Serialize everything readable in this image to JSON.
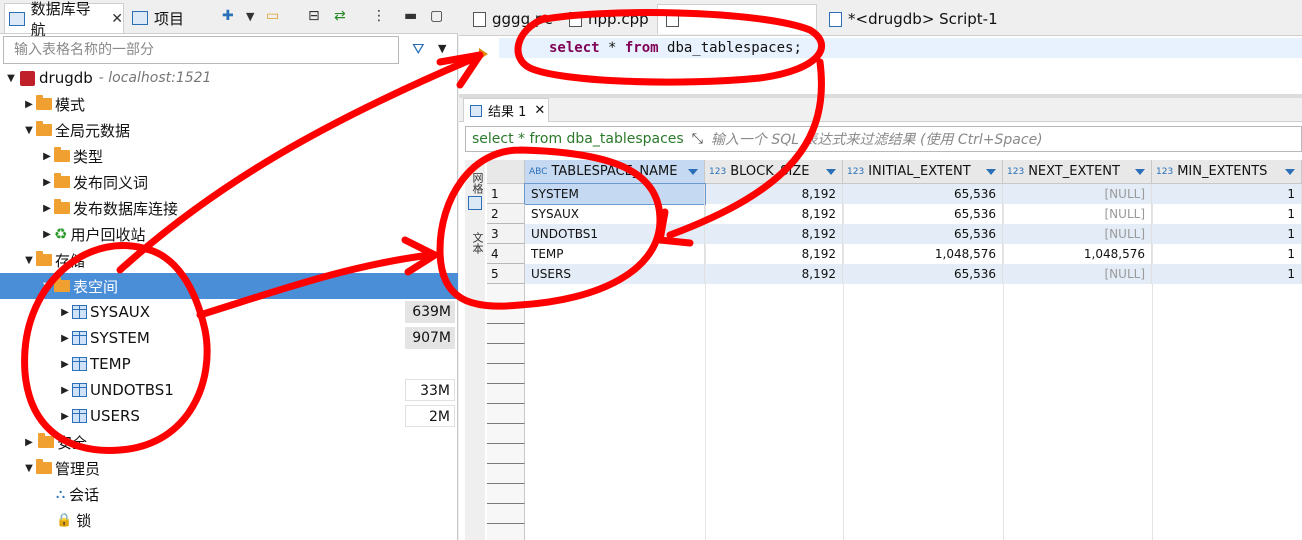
{
  "navigator": {
    "tab_label": "数据库导航",
    "projects_tab_label": "项目",
    "close_glyph": "✕",
    "filter_placeholder": "输入表格名称的一部分",
    "tree": {
      "connection": {
        "name": "drugdb",
        "host": "- localhost:1521"
      },
      "schemas": "模式",
      "global_metadata": "全局元数据",
      "types": "类型",
      "public_synonyms": "发布同义词",
      "public_db_links": "发布数据库连接",
      "recycle_bin": "用户回收站",
      "storage": "存储",
      "tablespaces": "表空间",
      "tablespace_items": [
        {
          "name": "SYSAUX",
          "size": "639M"
        },
        {
          "name": "SYSTEM",
          "size": "907M"
        },
        {
          "name": "TEMP",
          "size": ""
        },
        {
          "name": "UNDOTBS1",
          "size": "33M"
        },
        {
          "name": "USERS",
          "size": "2M"
        }
      ],
      "security": "安全",
      "administer": "管理员",
      "sessions": "会话",
      "locks": "锁"
    }
  },
  "editor": {
    "tabs": [
      "gggg.pc",
      "npp.cpp",
      "",
      "*<drugdb> Script-1"
    ],
    "sql": {
      "kw1": "select",
      "mid": " * ",
      "kw2": "from",
      "rest": " dba_tablespaces;"
    },
    "results_tab": "结果 1",
    "query_text": "select * from dba_tablespaces",
    "filter_placeholder": "输入一个 SQL 表达式来过滤结果 (使用 Ctrl+Space)",
    "side_tabs": {
      "grid": "网格",
      "text": "文本"
    }
  },
  "grid": {
    "type_badges": {
      "text": "ABC",
      "number": "123"
    },
    "columns": [
      "TABLESPACE_NAME",
      "BLOCK_SIZE",
      "INITIAL_EXTENT",
      "NEXT_EXTENT",
      "MIN_EXTENTS"
    ],
    "rows": [
      {
        "n": "1",
        "name": "SYSTEM",
        "block": "8,192",
        "initial": "65,536",
        "next": "[NULL]",
        "min": "1"
      },
      {
        "n": "2",
        "name": "SYSAUX",
        "block": "8,192",
        "initial": "65,536",
        "next": "[NULL]",
        "min": "1"
      },
      {
        "n": "3",
        "name": "UNDOTBS1",
        "block": "8,192",
        "initial": "65,536",
        "next": "[NULL]",
        "min": "1"
      },
      {
        "n": "4",
        "name": "TEMP",
        "block": "8,192",
        "initial": "1,048,576",
        "next": "1,048,576",
        "min": "1"
      },
      {
        "n": "5",
        "name": "USERS",
        "block": "8,192",
        "initial": "65,536",
        "next": "[NULL]",
        "min": "1"
      }
    ]
  },
  "colors": {
    "selection": "#4a8ed8",
    "annotation": "#ff0000",
    "keyword": "#7f0055",
    "query": "#2b7a2b"
  }
}
